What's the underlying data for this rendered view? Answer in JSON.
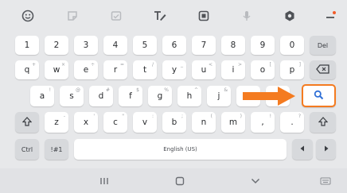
{
  "toolbar": {
    "items": [
      "emoji-icon",
      "sticker-icon",
      "gif-icon",
      "handwriting-icon",
      "clipboard-icon",
      "mic-icon",
      "settings-icon",
      "more-icon"
    ]
  },
  "rows": {
    "numbers": [
      {
        "label": "1"
      },
      {
        "label": "2"
      },
      {
        "label": "3"
      },
      {
        "label": "4"
      },
      {
        "label": "5"
      },
      {
        "label": "6"
      },
      {
        "label": "7"
      },
      {
        "label": "8"
      },
      {
        "label": "9"
      },
      {
        "label": "0"
      },
      {
        "label": "Del"
      }
    ],
    "qwerty": [
      {
        "label": "q",
        "hint": "+"
      },
      {
        "label": "w",
        "hint": "×"
      },
      {
        "label": "e",
        "hint": "÷"
      },
      {
        "label": "r",
        "hint": "="
      },
      {
        "label": "t",
        "hint": "/"
      },
      {
        "label": "y",
        "hint": "_"
      },
      {
        "label": "u",
        "hint": "<"
      },
      {
        "label": "i",
        "hint": ">"
      },
      {
        "label": "o",
        "hint": "["
      },
      {
        "label": "p",
        "hint": "]"
      }
    ],
    "asdf": [
      {
        "label": "a",
        "hint": "!"
      },
      {
        "label": "s",
        "hint": "@"
      },
      {
        "label": "d",
        "hint": "#"
      },
      {
        "label": "f",
        "hint": "$"
      },
      {
        "label": "g",
        "hint": "%"
      },
      {
        "label": "h",
        "hint": "^"
      },
      {
        "label": "j",
        "hint": "&"
      }
    ],
    "zxcv": [
      {
        "label": "z",
        "hint": "-"
      },
      {
        "label": "x",
        "hint": "'"
      },
      {
        "label": "c",
        "hint": "\""
      },
      {
        "label": "v",
        "hint": ":"
      },
      {
        "label": "b",
        "hint": ";"
      },
      {
        "label": "n",
        "hint": "("
      },
      {
        "label": "m",
        "hint": ")"
      },
      {
        "label": ",",
        "hint": "!"
      },
      {
        "label": ".",
        "hint": "?"
      }
    ],
    "bottom": {
      "ctrl": "Ctrl",
      "symbols": "!#1",
      "space": "English (US)"
    }
  },
  "colors": {
    "accent": "#f47b20",
    "search_icon": "#2f6fd6"
  }
}
